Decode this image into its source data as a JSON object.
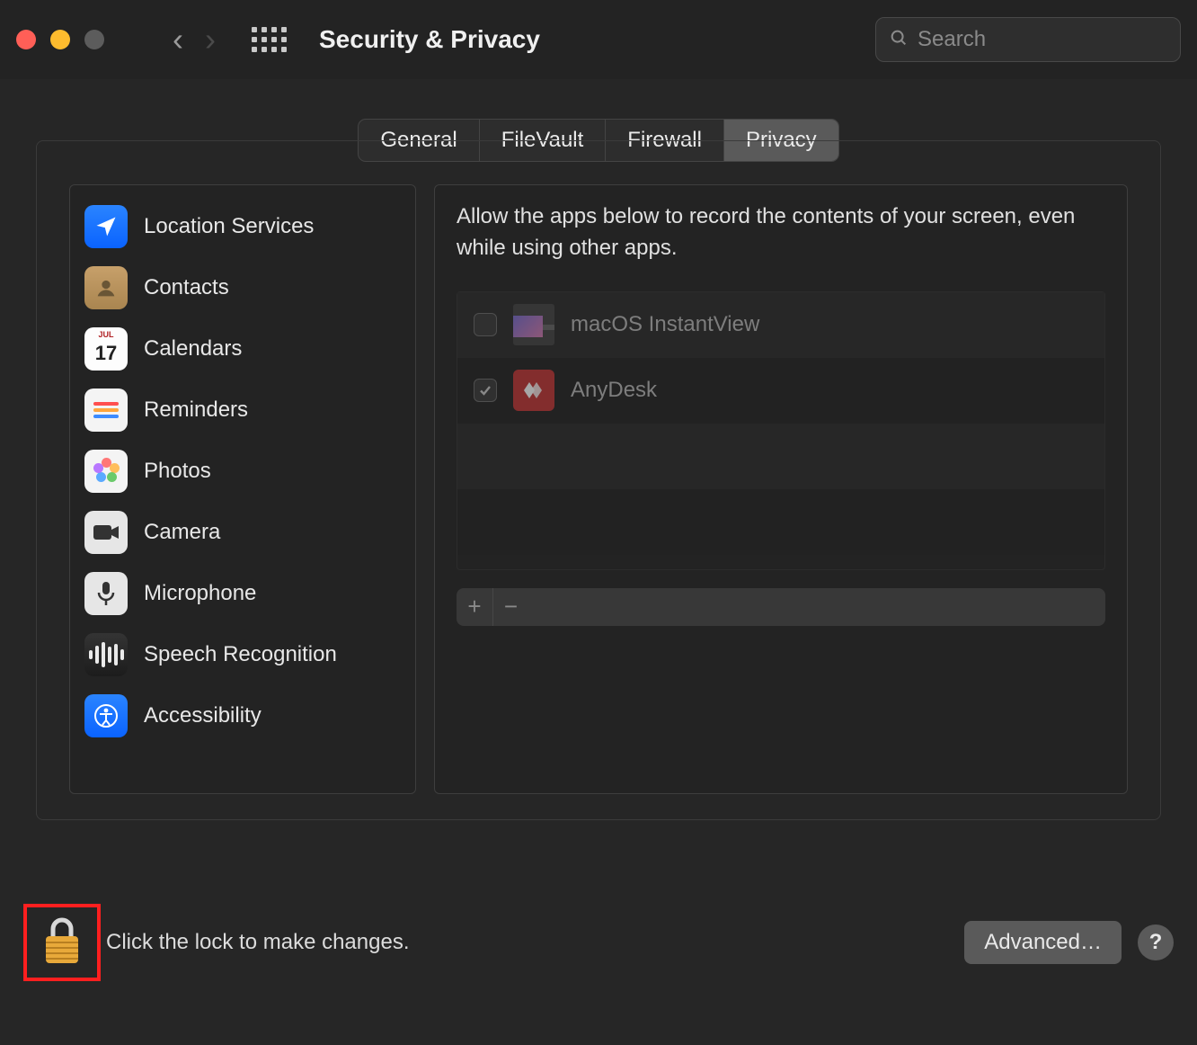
{
  "window": {
    "title": "Security & Privacy"
  },
  "search": {
    "placeholder": "Search",
    "value": ""
  },
  "tabs": [
    {
      "label": "General",
      "active": false
    },
    {
      "label": "FileVault",
      "active": false
    },
    {
      "label": "Firewall",
      "active": false
    },
    {
      "label": "Privacy",
      "active": true
    }
  ],
  "categories": [
    {
      "id": "location-services",
      "label": "Location Services"
    },
    {
      "id": "contacts",
      "label": "Contacts"
    },
    {
      "id": "calendars",
      "label": "Calendars",
      "calendar_month": "JUL",
      "calendar_day": "17"
    },
    {
      "id": "reminders",
      "label": "Reminders"
    },
    {
      "id": "photos",
      "label": "Photos"
    },
    {
      "id": "camera",
      "label": "Camera"
    },
    {
      "id": "microphone",
      "label": "Microphone"
    },
    {
      "id": "speech-recognition",
      "label": "Speech Recognition"
    },
    {
      "id": "accessibility",
      "label": "Accessibility"
    }
  ],
  "main": {
    "description": "Allow the apps below to record the contents of your screen, even while using other apps.",
    "apps": [
      {
        "name": "macOS InstantView",
        "checked": false
      },
      {
        "name": "AnyDesk",
        "checked": true
      }
    ]
  },
  "footer": {
    "lock_hint": "Click the lock to make changes.",
    "advanced_label": "Advanced…",
    "help_label": "?",
    "add_label": "+",
    "remove_label": "−"
  }
}
